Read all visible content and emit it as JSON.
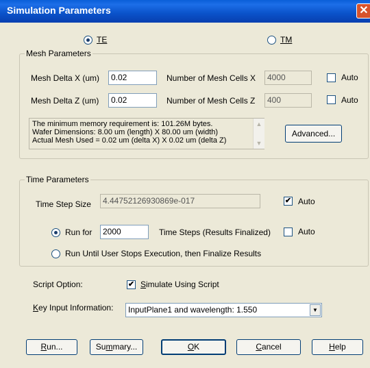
{
  "window": {
    "title": "Simulation Parameters",
    "close_glyph": "✕"
  },
  "mode": {
    "te_label": "TE",
    "tm_label": "TM",
    "selected": "TE"
  },
  "mesh": {
    "group_label": "Mesh Parameters",
    "delta_x_label": "Mesh Delta X (um)",
    "delta_x_value": "0.02",
    "delta_z_label": "Mesh Delta Z (um)",
    "delta_z_value": "0.02",
    "cells_x_label": "Number of Mesh Cells X",
    "cells_x_value": "4000",
    "cells_z_label": "Number of Mesh Cells Z",
    "cells_z_value": "400",
    "auto_x_label": "Auto",
    "auto_z_label": "Auto",
    "info_lines": [
      "The minimum memory requirement is: 101.26M bytes.",
      "Wafer Dimensions: 8.00 um (length) X 80.00 um (width)",
      "Actual Mesh Used = 0.02 um (delta X) X 0.02 um (delta Z)"
    ],
    "advanced_label": "Advanced..."
  },
  "time": {
    "group_label": "Time Parameters",
    "step_size_label": "Time Step Size",
    "step_size_value": "4.44752126930869e-017",
    "step_auto_label": "Auto",
    "step_auto_checked": true,
    "run_for_label": "Run for",
    "run_for_value": "2000",
    "time_steps_label": "Time Steps (Results Finalized)",
    "run_for_auto_label": "Auto",
    "run_until_label": "Run Until User Stops Execution, then Finalize Results",
    "selected": "run_for"
  },
  "script": {
    "option_label": "Script Option:",
    "simulate_label": "Simulate Using Script",
    "simulate_checked": true,
    "key_input_label": "Key Input Information:",
    "key_input_value": "InputPlane1 and wavelength: 1.550"
  },
  "buttons": {
    "run": "Run...",
    "summary": "Summary...",
    "ok": "OK",
    "cancel": "Cancel",
    "help": "Help"
  },
  "icons": {
    "check": "✔",
    "dropdown": "▼",
    "scroll_up": "▲",
    "scroll_down": "▼"
  }
}
